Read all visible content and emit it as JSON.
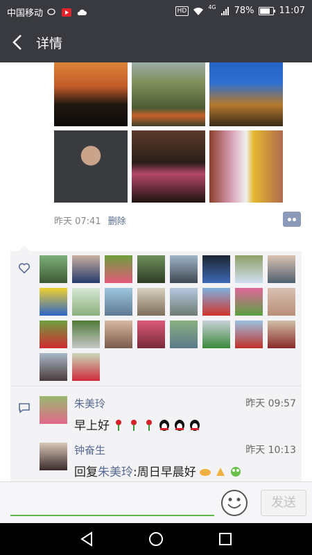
{
  "status": {
    "carrier": "中国移动",
    "battery": "78%",
    "time": "11:07",
    "hd": "HD",
    "network": "4G"
  },
  "header": {
    "title": "详情",
    "back_icon": "back-arrow-icon"
  },
  "post": {
    "time": "昨天 07:41",
    "delete_label": "删除",
    "photo_count": 6
  },
  "likes": {
    "icon": "heart-outline-icon",
    "avatar_count": 26
  },
  "comments": [
    {
      "name": "朱美玲",
      "time": "昨天 09:57",
      "text": "早上好",
      "emoji": [
        "rose",
        "rose",
        "rose",
        "penguin",
        "penguin",
        "penguin"
      ]
    },
    {
      "name": "钟奋生",
      "time": "昨天 10:13",
      "reply_prefix": "回复",
      "reply_to": "朱美玲",
      "text": ":周日早晨好",
      "emoji": [
        "handshake",
        "clap",
        "frog"
      ]
    }
  ],
  "input": {
    "placeholder": "",
    "send_label": "发送",
    "emoji_icon": "smiley-icon"
  },
  "colors": {
    "bar": "#393a3f",
    "link": "#576b95",
    "accent": "#5fb84a"
  }
}
